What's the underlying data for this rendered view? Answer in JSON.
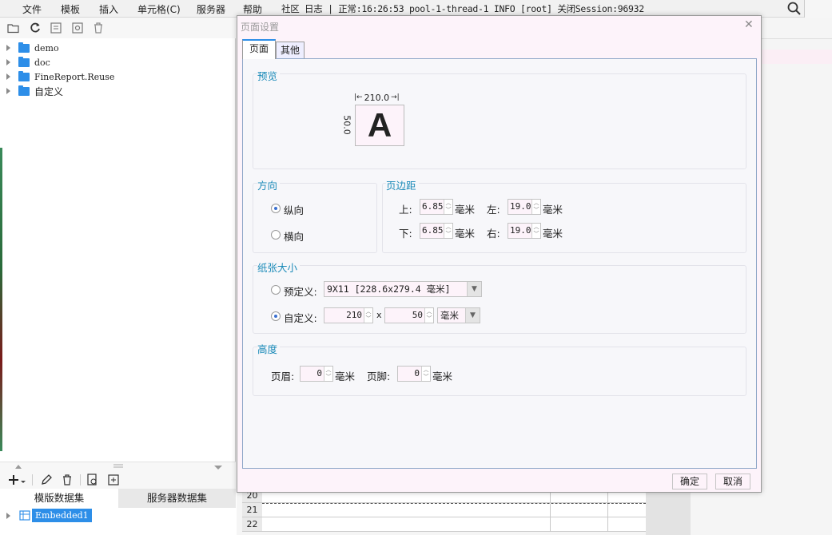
{
  "menubar": {
    "items": [
      "文件",
      "模板",
      "插入",
      "单元格(C)",
      "服务器",
      "帮助",
      "社区",
      "日志"
    ],
    "status": "| 正常:16:26:53 pool-1-thread-1 INFO [root] 关闭Session:96932"
  },
  "tree": {
    "items": [
      {
        "label": "demo"
      },
      {
        "label": "doc"
      },
      {
        "label": "FineReport.Reuse"
      },
      {
        "label": "自定义"
      }
    ]
  },
  "datasets": {
    "tabs": [
      "模版数据集",
      "服务器数据集"
    ],
    "items": [
      "Embedded1"
    ]
  },
  "sheet": {
    "rows": [
      "20",
      "21",
      "22"
    ]
  },
  "dialog": {
    "title": "页面设置",
    "tabs": [
      "页面",
      "其他"
    ],
    "preview": {
      "title": "预览",
      "width_label": "210.0",
      "height_label": "50.0",
      "letter": "A"
    },
    "orientation": {
      "title": "方向",
      "portrait": "纵向",
      "landscape": "横向",
      "selected": "纵向"
    },
    "margins": {
      "title": "页边距",
      "top_label": "上:",
      "top_value": "6.85",
      "left_label": "左:",
      "left_value": "19.05",
      "bottom_label": "下:",
      "bottom_value": "6.85",
      "right_label": "右:",
      "right_value": "19.05",
      "unit": "毫米"
    },
    "paper": {
      "title": "纸张大小",
      "predefined_label": "预定义:",
      "predefined_value": "9X11 [228.6x279.4 毫米]",
      "custom_label": "自定义:",
      "width_value": "210",
      "x_label": "x",
      "height_value": "50",
      "unit_value": "毫米",
      "selected": "自定义"
    },
    "height": {
      "title": "高度",
      "header_label": "页眉:",
      "header_value": "0",
      "footer_label": "页脚:",
      "footer_value": "0",
      "unit": "毫米"
    },
    "buttons": {
      "ok": "确定",
      "cancel": "取消"
    }
  },
  "colors": {
    "accent": "#2d8ee8",
    "group_title": "#1a8ab8",
    "dialog_bg": "#fdf3fa"
  }
}
